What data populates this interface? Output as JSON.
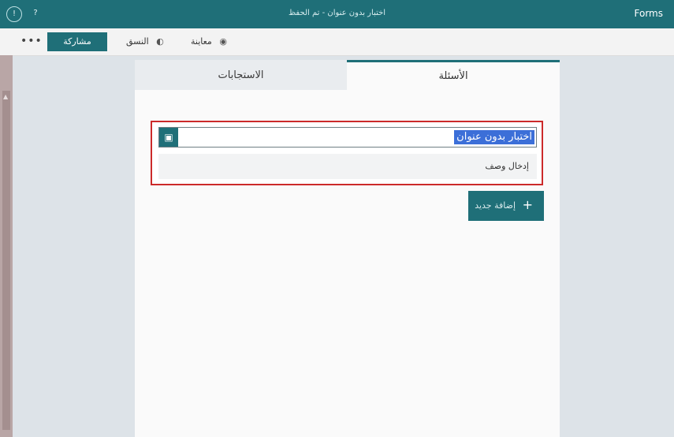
{
  "app": {
    "brand": "Forms",
    "document_title": "اختبار بدون عنوان - تم الحفظ"
  },
  "topbar_icons": [
    "account-icon",
    "help-icon"
  ],
  "command_bar": {
    "more_label": "•••",
    "share_label": "مشاركة",
    "theme_label": "النسق",
    "preview_label": "معاينة"
  },
  "tabs": {
    "responses": "الاستجابات",
    "questions": "الأسئلة"
  },
  "form_card": {
    "title_value": "اختبار بدون عنوان",
    "description_placeholder": "إدخال وصف"
  },
  "add_new": {
    "label": "إضافة جديد",
    "icon": "+"
  },
  "colors": {
    "accent": "#1f6f78",
    "highlight_border": "#cc2a2a",
    "selection": "#3c6fd8"
  }
}
